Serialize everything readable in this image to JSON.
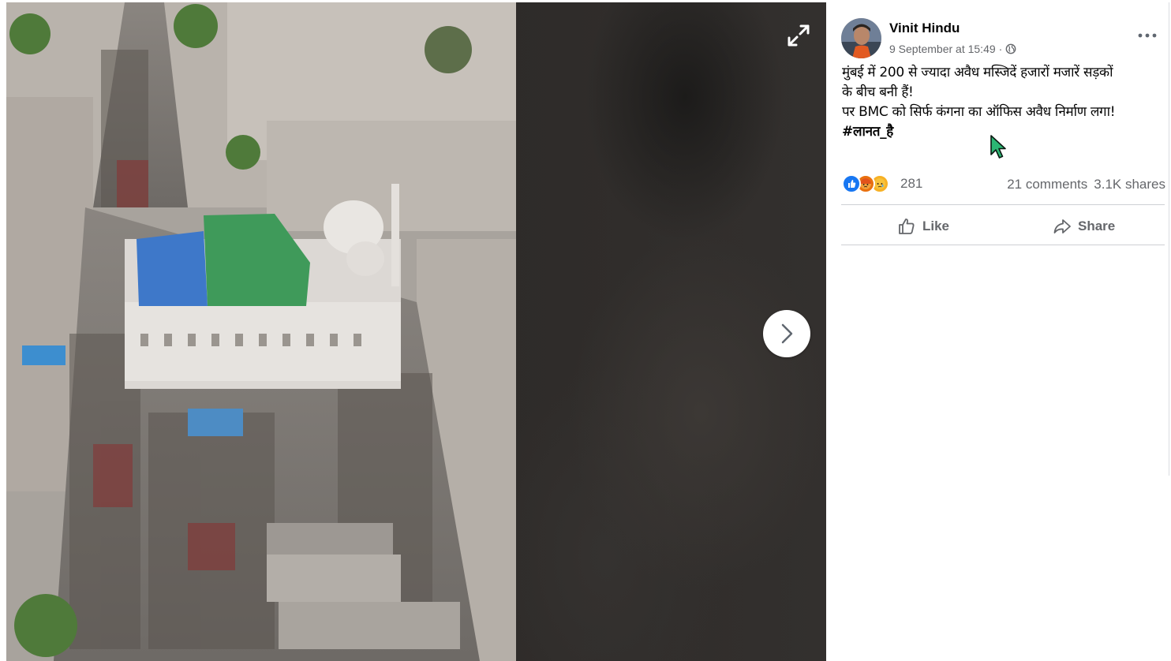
{
  "media": {
    "expand_icon": "expand-arrows-icon",
    "next_icon": "chevron-right-icon"
  },
  "post": {
    "author": "Vinit Hindu",
    "timestamp": "9 September at 15:49",
    "separator": "·",
    "audience_icon": "globe-icon",
    "more_icon": "ellipsis-icon",
    "text_lines": [
      "मुंबई में 200 से ज्यादा अवैध मस्जिदें हजारों मजारें सड़कों",
      "के बीच बनी हैं!",
      "पर BMC को सिर्फ कंगना का ऑफिस अवैध निर्माण लगा!"
    ],
    "hashtag": "#लानत_है"
  },
  "engagement": {
    "reactions": [
      "like",
      "angry",
      "sad"
    ],
    "reaction_count": "281",
    "comments": "21 comments",
    "shares": "3.1K shares"
  },
  "actions": {
    "like_label": "Like",
    "share_label": "Share"
  },
  "colors": {
    "like_blue": "#1877f2",
    "angry_orange": "#e9710f",
    "sad_yellow": "#f7b125",
    "text_secondary": "#65676b",
    "cursor_fill": "#2bb673"
  }
}
